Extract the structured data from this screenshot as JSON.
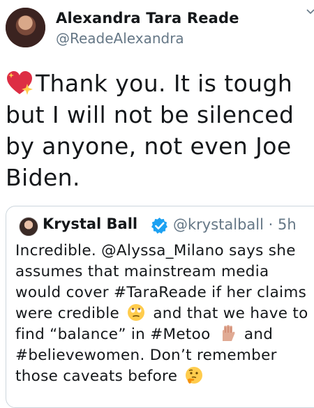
{
  "author": {
    "name": "Alexandra Tara Reade",
    "handle": "@ReadeAlexandra"
  },
  "tweet": {
    "text": "Thank you. It is tough but I will not be silenced by anyone, not even Joe Biden.",
    "leading_emoji": "sparkling-heart-icon"
  },
  "quoted_tweet": {
    "name": "Krystal Ball",
    "handle": "@krystalball",
    "separator": "·",
    "time": "5h",
    "text_1": "Incredible. @Alyssa_Milano says she assumes that mainstream media would cover #TaraReade if her claims were credible",
    "text_2": "and that we have to find “balance” in #Metoo",
    "text_3": "and #believewomen. Don’t remember those caveats before",
    "emojis": [
      "face-with-rolling-eyes-icon",
      "raised-hand-icon",
      "thinking-face-icon"
    ]
  },
  "colors": {
    "text": "#14171a",
    "secondary": "#657786",
    "verified": "#1da1f2",
    "border": "#ccd6dd"
  }
}
